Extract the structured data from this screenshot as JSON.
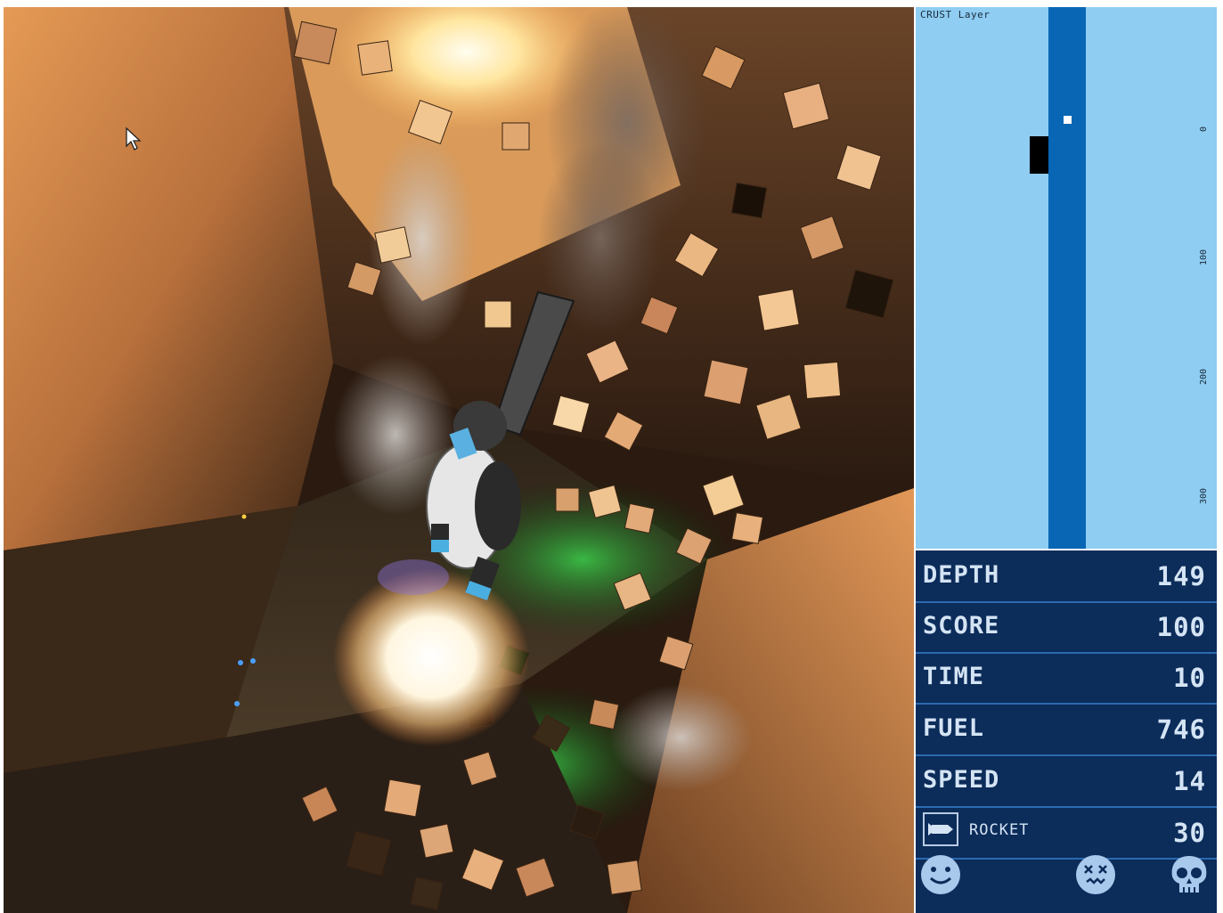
{
  "minimap": {
    "layer_label": "CRUST Layer",
    "depth_ticks": [
      "0",
      "100",
      "200",
      "300"
    ],
    "colors": {
      "background": "#8fcdf2",
      "shaft": "#0866b4",
      "player": "#ffffff",
      "marker": "#000000"
    }
  },
  "stats": [
    {
      "label": "DEPTH",
      "value": "149"
    },
    {
      "label": "SCORE",
      "value": "100"
    },
    {
      "label": "TIME",
      "value": "10"
    },
    {
      "label": "FUEL",
      "value": "746"
    },
    {
      "label": "SPEED",
      "value": "14"
    }
  ],
  "weapon": {
    "icon": "rocket-icon",
    "label": "ROCKET",
    "value": "30"
  },
  "faces": [
    {
      "icon": "smiley-face-icon"
    },
    {
      "icon": "dizzy-face-icon"
    },
    {
      "icon": "skull-icon"
    }
  ],
  "viewport": {
    "icon": "mouse-cursor-icon"
  },
  "colors": {
    "panel": "#0c2c5a",
    "panel_divider": "#2c6ab0",
    "panel_text": "#d4e4f4"
  }
}
